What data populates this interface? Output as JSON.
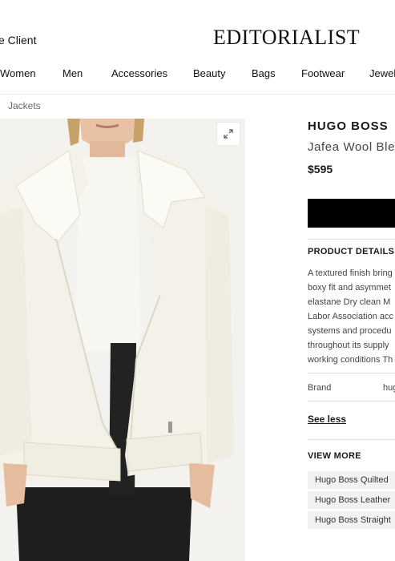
{
  "header": {
    "client_link": "e Client",
    "logo": "EDITORIALIST"
  },
  "nav": {
    "items": [
      "Women",
      "Men",
      "Accessories",
      "Beauty",
      "Bags",
      "Footwear",
      "Jewel"
    ]
  },
  "breadcrumb": "Jackets",
  "product": {
    "brand": "HUGO BOSS",
    "name": "Jafea Wool Ble",
    "price": "$595",
    "details_title": "PRODUCT DETAILS",
    "details_lines": [
      "A textured finish bring",
      "boxy fit and asymmet",
      "elastane Dry clean M",
      "Labor Association acc",
      "systems and procedu",
      "throughout its supply",
      "working conditions Th"
    ],
    "attribute_label": "Brand",
    "attribute_value": "hug",
    "see_less": "See less"
  },
  "view_more": {
    "title": "VIEW MORE",
    "items": [
      "Hugo Boss Quilted",
      "Hugo Boss Leather",
      "Hugo Boss Straight"
    ]
  },
  "colors": {
    "coat": "#f4f2e8",
    "button": "#000000",
    "chip_bg": "#f2f2f2"
  },
  "icons": {
    "expand": "expand-icon"
  }
}
